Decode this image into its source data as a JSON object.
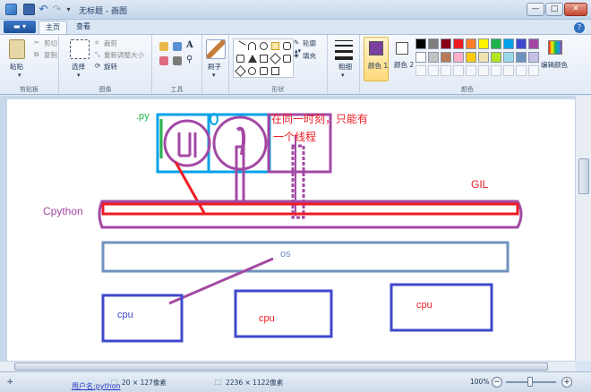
{
  "window": {
    "title": "无标题 - 画图",
    "min_glyph": "—",
    "max_glyph": "□",
    "close_glyph": "✕"
  },
  "tabs": {
    "file": "▬ ▾",
    "home": "主页",
    "view": "查看",
    "help": "?"
  },
  "ribbon": {
    "clipboard": {
      "label": "剪贴板",
      "paste": "粘贴",
      "cut": "剪切",
      "copy": "复制"
    },
    "image": {
      "label": "图像",
      "select": "选择",
      "crop": "裁剪",
      "resize": "重新调整大小",
      "rotate": "旋转"
    },
    "tools": {
      "label": "工具"
    },
    "brushes": {
      "label": "刷子"
    },
    "shapes": {
      "label": "形状",
      "outline": "轮廓",
      "fill": "填充"
    },
    "size": {
      "label": "粗细"
    },
    "colors": {
      "label": "颜色",
      "color1": "颜色 1",
      "color2": "颜色 2",
      "edit_colors": "编辑颜色",
      "color1_value": "#7b3fa0",
      "color2_value": "#ffffff",
      "palette_row1": [
        "#000000",
        "#7f7f7f",
        "#880015",
        "#ed1c24",
        "#ff7f27",
        "#fff200",
        "#22b14c",
        "#00a2e8",
        "#3f48cc",
        "#a349a4"
      ],
      "palette_row2": [
        "#ffffff",
        "#c3c3c3",
        "#b97a57",
        "#ffaec9",
        "#ffc90e",
        "#efe4b0",
        "#b5e61d",
        "#99d9ea",
        "#7092be",
        "#c8bfe7"
      ]
    }
  },
  "canvas": {
    "text_py": ".py",
    "text_note_line1": "在同一时刻，只能有",
    "text_note_line2": "一个线程",
    "text_gil": "GIL",
    "text_cpython": "Cpython",
    "text_os": "os",
    "text_cpu1": "cpu",
    "text_cpu2": "cpu",
    "text_cpu3": "cpu",
    "colors": {
      "green": "#22b14c",
      "cyan": "#00a2e8",
      "purple": "#a349a4",
      "red": "#ed1c24",
      "blue": "#3f48cc",
      "steel": "#7092be"
    }
  },
  "status": {
    "cursor_pos": "20 × 127像素",
    "canvas_size": "2236 × 1122像素",
    "zoom": "100%",
    "user": "用户名:python"
  }
}
